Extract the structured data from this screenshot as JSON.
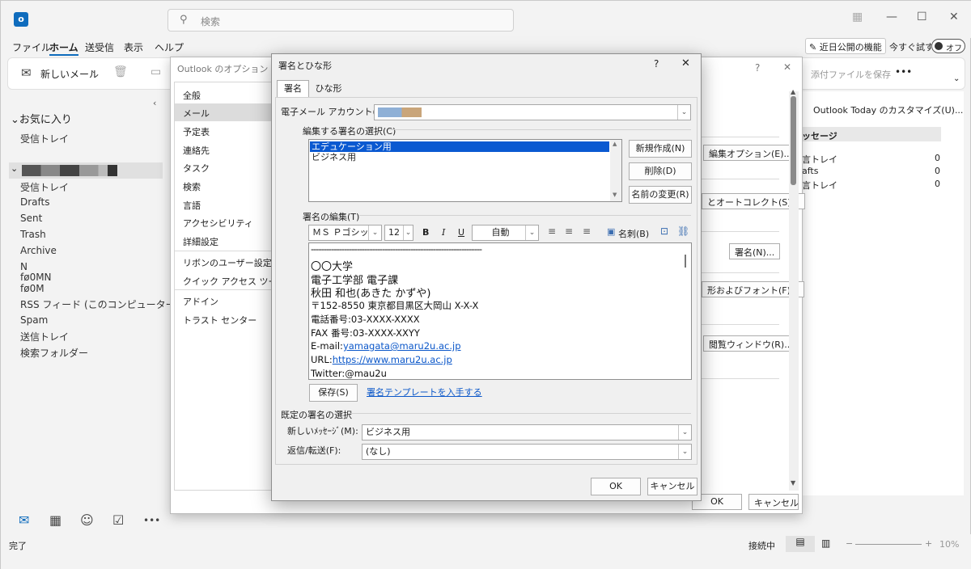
{
  "app": {
    "search_placeholder": "検索",
    "menu": [
      "ファイル",
      "ホーム",
      "送受信",
      "表示",
      "ヘルプ"
    ],
    "coming_features": "近日公開の機能",
    "try_now": "今すぐ試す",
    "toggle_off": "オフ",
    "new_mail": "新しいメール",
    "save_attachment": "添付ファイルを保存",
    "more": "•••"
  },
  "left": {
    "favorites": "お気に入り",
    "fav_inbox": "受信トレイ",
    "folders": [
      "受信トレイ",
      "Drafts",
      "Sent",
      "Trash",
      "Archive",
      "N",
      "fø0MN",
      "fø0M",
      "RSS フィード (このコンピューターのみ)",
      "Spam",
      "送信トレイ",
      "検索フォルダー"
    ]
  },
  "right": {
    "outlook_today": "Outlook Today のカスタマイズ(U)...",
    "messages_header": "ッセージ",
    "rows": [
      {
        "name": "言トレイ",
        "count": "0"
      },
      {
        "name": "afts",
        "count": "0"
      },
      {
        "name": "言トレイ",
        "count": "0"
      }
    ]
  },
  "status": {
    "left": "完了",
    "connected": "接続中",
    "zoom_minus": "−",
    "zoom_plus": "+",
    "zoom": "10%"
  },
  "options": {
    "title": "Outlook のオプション",
    "help": "?",
    "close": "✕",
    "nav": [
      "全般",
      "メール",
      "予定表",
      "連絡先",
      "タスク",
      "検索",
      "言語",
      "アクセシビリティ",
      "詳細設定",
      "リボンのユーザー設定",
      "クイック アクセス ツール バー",
      "アドイン",
      "トラスト センター"
    ],
    "btn_edit_options": "編集オプション(E)...",
    "btn_autocorrect": "とオートコレクト(S)...",
    "btn_signature": "署名(N)...",
    "btn_stationery": "形およびフォント(F)...",
    "btn_reading": "閲覧ウィンドウ(R)...",
    "ok": "OK",
    "cancel": "キャンセル"
  },
  "sig": {
    "title": "署名とひな形",
    "help": "?",
    "close": "✕",
    "tabs": [
      "署名",
      "ひな形"
    ],
    "account_label": "電子メール アカウント(A):",
    "select_group": "編集する署名の選択(C)",
    "signatures": [
      "エデュケーション用",
      "ビジネス用"
    ],
    "btn_new": "新規作成(N)",
    "btn_delete": "削除(D)",
    "btn_rename": "名前の変更(R)",
    "edit_group": "署名の編集(T)",
    "font": "ＭＳ Ｐゴシック",
    "size": "12",
    "bold": "B",
    "italic": "I",
    "underline": "U",
    "color": "自動",
    "business_card": "名刺(B)",
    "body": {
      "rule": "-------------------------------------------------------------------",
      "l1": "〇〇大学",
      "l2": "電子工学部  電子課",
      "l3": "秋田  和也(あきた  かずや)",
      "l4": "〒152-8550  東京都目黒区大岡山  X-X-X",
      "l5": "電話番号:03-XXXX-XXXX",
      "l6": "FAX 番号:03-XXXX-XXYY",
      "email_label": "E-mail:",
      "email": "yamagata@maru2u.ac.jp",
      "url_label": "URL:",
      "url": "https://www.maru2u.ac.jp",
      "twitter": "Twitter:@mau2u"
    },
    "save": "保存(S)",
    "template_link": "署名テンプレートを入手する",
    "default_group": "既定の署名の選択",
    "new_msg_label": "新しいﾒｯｾｰｼﾞ(M):",
    "new_msg_value": "ビジネス用",
    "reply_label": "返信/転送(F):",
    "reply_value": "(なし)",
    "ok": "OK",
    "cancel": "キャンセル"
  },
  "colors": {
    "accent": "#0f6cbd",
    "selection": "#0a59d1",
    "link": "#0b57c9"
  }
}
